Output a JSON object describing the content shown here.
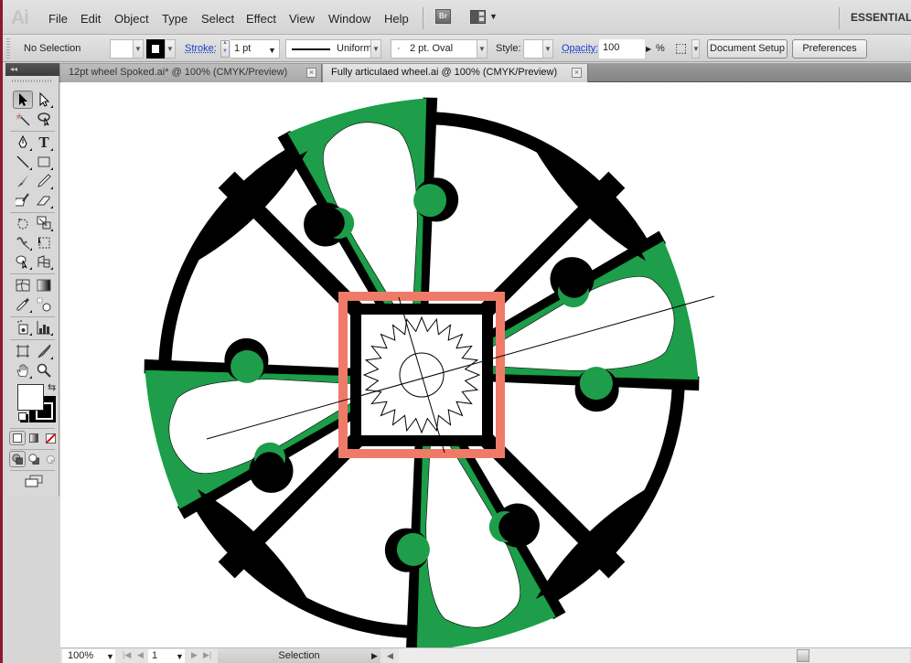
{
  "app": {
    "logo": "Ai",
    "workspace": "ESSENTIALS",
    "bridge_label": "Br"
  },
  "menu": [
    "File",
    "Edit",
    "Object",
    "Type",
    "Select",
    "Effect",
    "View",
    "Window",
    "Help"
  ],
  "control_bar": {
    "selection_status": "No Selection",
    "stroke_label": "Stroke:",
    "stroke_weight": "1 pt",
    "stroke_profile": "Uniform",
    "brush": "2 pt. Oval",
    "brush_bullet": "·",
    "style_label": "Style:",
    "opacity_label": "Opacity:",
    "opacity_value": "100",
    "opacity_unit": "%",
    "document_setup": "Document Setup",
    "preferences": "Preferences"
  },
  "tabs": [
    {
      "label": "12pt wheel  Spoked.ai* @ 100% (CMYK/Preview)",
      "active": false
    },
    {
      "label": "Fully articulaed wheel.ai @ 100% (CMYK/Preview)",
      "active": true
    }
  ],
  "tools_panel": {
    "collapse_icon": "◂◂"
  },
  "status_bar": {
    "zoom": "100%",
    "page": "1",
    "tool_status": "Selection"
  },
  "colors": {
    "green": "#1e9d4a",
    "salmon": "#f07a68",
    "black": "#000000"
  }
}
